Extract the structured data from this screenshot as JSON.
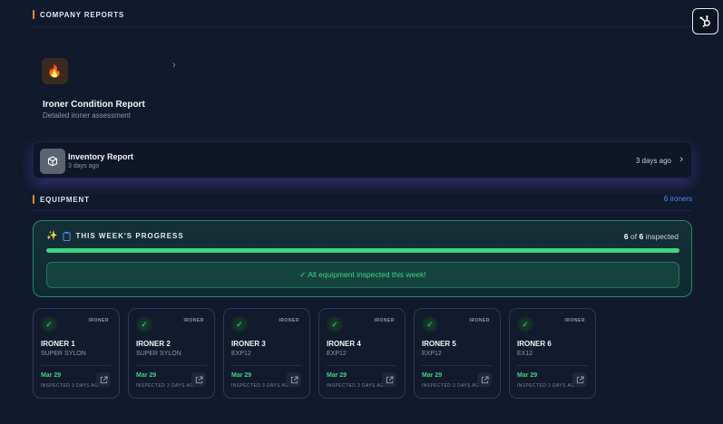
{
  "company_reports": {
    "heading": "COMPANY REPORTS"
  },
  "ironer_report": {
    "icon": "fire-icon",
    "title": "Ironer Condition Report",
    "subtitle": "Detailed ironer assessment"
  },
  "inventory_report": {
    "icon": "box-icon",
    "title": "Inventory Report",
    "subtitle": "3 days ago",
    "right_text": "3 days ago"
  },
  "equipment": {
    "heading": "EQUIPMENT",
    "count_link": "6 ironers"
  },
  "progress": {
    "title": "THIS WEEK'S PROGRESS",
    "inspected": "6",
    "of_label": "of",
    "total": "6",
    "suffix": "inspected",
    "fraction": 1.0,
    "message": "✓ All equipment inspected this week!"
  },
  "colors": {
    "accent_orange": "#f08a24",
    "success_green": "#3fd47f",
    "link_blue": "#4c8df6",
    "background": "#111a2c"
  },
  "ironers": [
    {
      "type": "IRONER",
      "name": "IRONER 1",
      "model": "SUPER SYLON",
      "date": "Mar 29",
      "inspected": "INSPECTED 3 DAYS AGO"
    },
    {
      "type": "IRONER",
      "name": "IRONER 2",
      "model": "SUPER SYLON",
      "date": "Mar 29",
      "inspected": "INSPECTED 3 DAYS AGO"
    },
    {
      "type": "IRONER",
      "name": "IRONER 3",
      "model": "EXP12",
      "date": "Mar 29",
      "inspected": "INSPECTED 3 DAYS AGO"
    },
    {
      "type": "IRONER",
      "name": "IRONER 4",
      "model": "EXP12",
      "date": "Mar 29",
      "inspected": "INSPECTED 3 DAYS AGO"
    },
    {
      "type": "IRONER",
      "name": "IRONER 5",
      "model": "EXP12",
      "date": "Mar 29",
      "inspected": "INSPECTED 3 DAYS AGO"
    },
    {
      "type": "IRONER",
      "name": "IRONER 6",
      "model": "EX12",
      "date": "Mar 29",
      "inspected": "INSPECTED 3 DAYS AGO"
    }
  ]
}
